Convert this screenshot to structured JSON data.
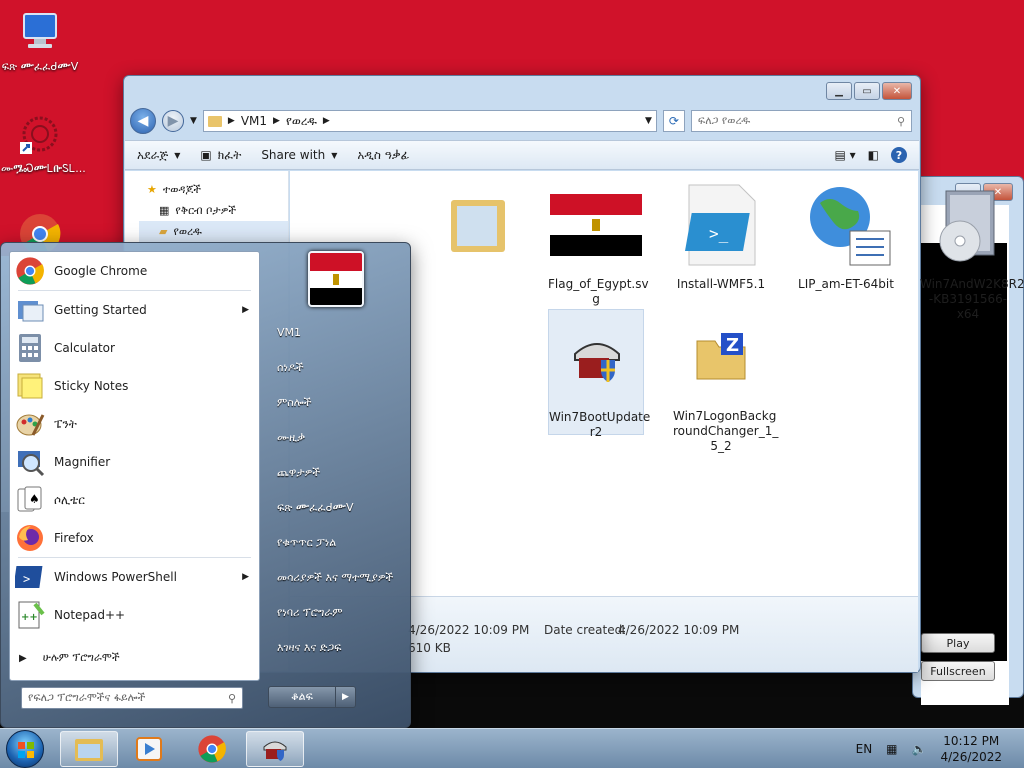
{
  "desktop": {
    "icons": [
      {
        "label": "ፍጽ ᎀፈፈᑯᎀᐯ"
      },
      {
        "label": "ሙᎂᏍᎀᏞᎄᏚᏞ..."
      },
      {
        "label": ""
      }
    ]
  },
  "explorer": {
    "address": {
      "segments": [
        "VM1",
        "የወረዱ"
      ]
    },
    "search_placeholder": "ፍለጋ የወረዱ",
    "toolbar": {
      "organize": "አደራጅ",
      "share": "ክፈት",
      "share_with": "Share with",
      "new_folder": "አዲስ ዓቃፊ"
    },
    "nav_items": [
      "ተወዳጆች",
      "የቅርብ ቦታዎች",
      "የወረዱ"
    ],
    "files": [
      {
        "name": "",
        "icon": "folder-icon"
      },
      {
        "name": "Flag_of_Egypt.sv g",
        "icon": "egypt-flag-icon"
      },
      {
        "name": "Install-WMF5.1",
        "icon": "powershell-script-icon"
      },
      {
        "name": "LIP_am-ET-64bit",
        "icon": "globe-language-pack-icon"
      },
      {
        "name": "Win7AndW2K8R2 -KB3191566-x64",
        "icon": "installer-cd-icon"
      },
      {
        "name": "Win7BootUpdate r2",
        "icon": "boot-updater-icon"
      },
      {
        "name": "Win7LogonBackg roundChanger_1_ 5_2",
        "icon": "zip-archive-icon"
      }
    ],
    "details": {
      "date_modified_value": "4/26/2022 10:09 PM",
      "date_created_label": "Date created:",
      "date_created_value": "4/26/2022 10:09 PM",
      "size_value": "610 KB"
    }
  },
  "player": {
    "play": "Play",
    "fullscreen": "Fullscreen"
  },
  "start_menu": {
    "programs": [
      {
        "label": "Google Chrome",
        "icon": "chrome-icon",
        "arrow": false
      },
      {
        "label": "Getting Started",
        "icon": "getting-started-icon",
        "arrow": true
      },
      {
        "label": "Calculator",
        "icon": "calculator-icon",
        "arrow": false
      },
      {
        "label": "Sticky Notes",
        "icon": "sticky-notes-icon",
        "arrow": false
      },
      {
        "label": "ፔንት",
        "icon": "paint-icon",
        "arrow": false
      },
      {
        "label": "Magnifier",
        "icon": "magnifier-icon",
        "arrow": false
      },
      {
        "label": "ሶሊቴር",
        "icon": "solitaire-icon",
        "arrow": false
      },
      {
        "label": "Firefox",
        "icon": "firefox-icon",
        "arrow": false
      },
      {
        "label": "Windows PowerShell",
        "icon": "powershell-icon",
        "arrow": true
      },
      {
        "label": "Notepad++",
        "icon": "notepad-plus-plus-icon",
        "arrow": false
      }
    ],
    "all_programs": "ሁሉም ፕሮግራሞች",
    "search_placeholder": "የፍለጋ ፕሮግራሞችና ፋይሎች",
    "right_items": [
      "VM1",
      "ሰነዶች",
      "ምስሎች",
      "ሙዚቃ",
      "ጨዋታዎች",
      "ፍጽ ᎀፈፈᑯᎀᐯ",
      "የቁጥጥር ፓነል",
      "መሳሪያዎች እና ማተሚያዎች",
      "የነባሪ ፕሮግራም",
      "እገዛና እና ድጋፍ"
    ],
    "shutdown": "ቆልፍ"
  },
  "taskbar": {
    "language": "EN",
    "time": "10:12 PM",
    "date": "4/26/2022"
  }
}
